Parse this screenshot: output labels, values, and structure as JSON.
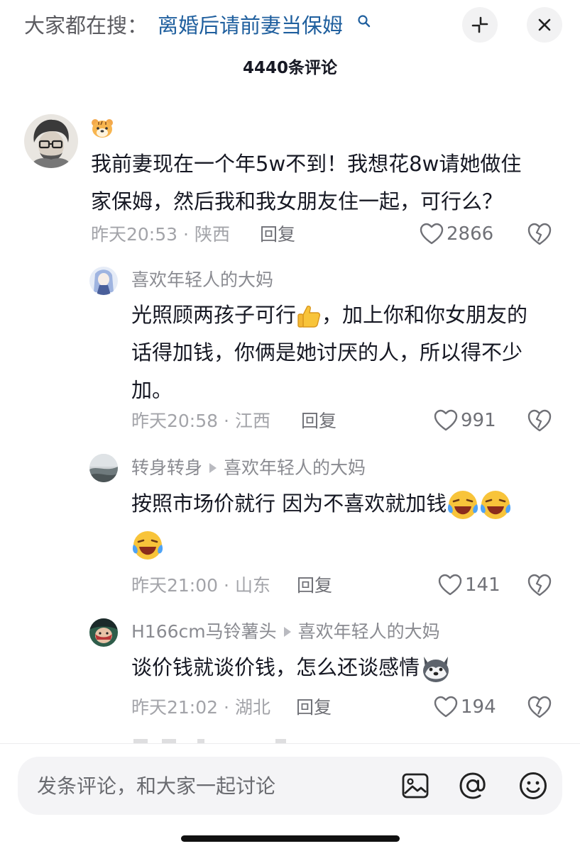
{
  "header": {
    "search_prefix": "大家都在搜：",
    "search_query": "离婚后请前妻当保姆",
    "icons": [
      "search-icon",
      "collapse-icon",
      "close-icon"
    ]
  },
  "comment_count": "4440条评论",
  "comments": [
    {
      "author": "",
      "author_badge": "tiger-emoji",
      "text_lines": [
        "我前妻现在一个年5w不到！我想花8w请她做住",
        "家保姆，然后我和我女朋友住一起，可行么？"
      ],
      "time": "昨天20:53",
      "location": "陕西",
      "reply_label": "回复",
      "likes": "2866"
    },
    {
      "author": "喜欢年轻人的大妈",
      "text_lines": [
        "光照顾两孩子可行",
        "，加上你和你女朋友的",
        "话得加钱，你俩是她讨厌的人，所以得不少",
        "加。"
      ],
      "time": "昨天20:58",
      "location": "江西",
      "reply_label": "回复",
      "likes": "991"
    },
    {
      "author": "转身转身",
      "reply_to": "喜欢年轻人的大妈",
      "text_lines": [
        "按照市场价就行  因为不喜欢就加钱"
      ],
      "time": "昨天21:00",
      "location": "山东",
      "reply_label": "回复",
      "likes": "141"
    },
    {
      "author": "H166cm马铃薯头",
      "reply_to": "喜欢年轻人的大妈",
      "text_lines": [
        "谈价钱就谈价钱，怎么还谈感情"
      ],
      "time": "昨天21:02",
      "location": "湖北",
      "reply_label": "回复",
      "likes": "194"
    }
  ],
  "input": {
    "placeholder": "发条评论，和大家一起讨论",
    "icons": [
      "image-icon",
      "at-icon",
      "emoji-icon"
    ]
  },
  "colors": {
    "query_link": "#1f5f9e",
    "text": "#161823",
    "meta": "#a3a4a9"
  }
}
